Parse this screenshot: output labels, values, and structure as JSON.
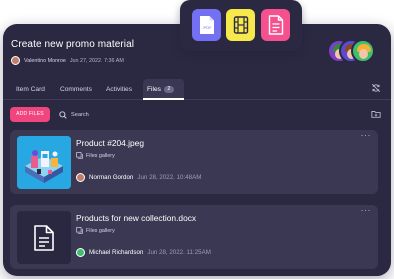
{
  "card": {
    "title": "Create new promo material",
    "author": "Valentino Monroe",
    "created": "Jun 27, 2022. 7:36 AM"
  },
  "tabs": [
    {
      "label": "Item Card"
    },
    {
      "label": "Comments"
    },
    {
      "label": "Activities"
    },
    {
      "label": "Files",
      "count": "2",
      "active": true
    }
  ],
  "toolbar": {
    "add_files_label": "ADD FILES",
    "search_label": "Search"
  },
  "files": [
    {
      "name": "Product #204.jpeg",
      "location": "Files gallery",
      "uploader": "Norman Gordon",
      "date": "Jun 28, 2022. 10:48AM",
      "thumbnail": "image-preview",
      "avatar_color": "#c07f6a"
    },
    {
      "name": "Products for new collection.docx",
      "location": "Files gallery",
      "uploader": "Michael Richardson",
      "date": "Jun 28, 2022. 11:25AM",
      "thumbnail": "document-icon",
      "avatar_color": "#3fbf6e"
    }
  ],
  "file_types": [
    {
      "icon": "pdf-file-icon",
      "label": ".PDF",
      "color": "#7370f2"
    },
    {
      "icon": "video-file-icon",
      "color": "#f7e94b"
    },
    {
      "icon": "text-document-icon",
      "color": "#f5518e"
    }
  ],
  "colors": {
    "background": "#2b2941",
    "row": "#3b3853",
    "accent": "#f0457e"
  }
}
